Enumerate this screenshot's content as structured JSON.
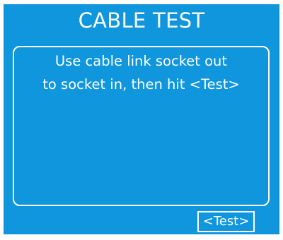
{
  "header": {
    "title": "CABLE TEST"
  },
  "instructions": {
    "line1": "Use cable link socket out",
    "line2": "to socket in, then hit <Test>"
  },
  "actions": {
    "test_label": "<Test>"
  },
  "colors": {
    "screen_background": "#1096dc",
    "foreground": "#ffffff"
  }
}
